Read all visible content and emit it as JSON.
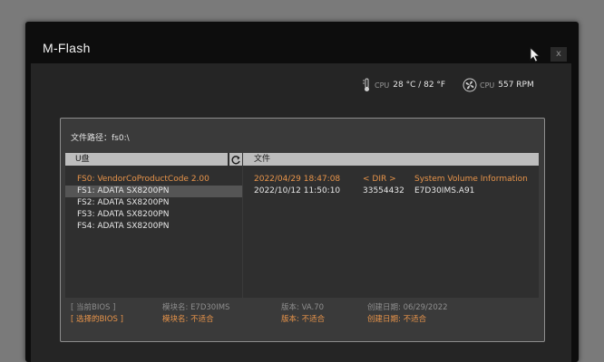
{
  "window": {
    "title": "M-Flash",
    "close_label": "x"
  },
  "stats": {
    "temp_label": "CPU",
    "temp_value": "28 °C / 82 °F",
    "fan_label": "CPU",
    "fan_value": "557 RPM"
  },
  "dialog": {
    "path": "文件路径：fs0:\\",
    "usb_header": "U盘",
    "file_header": "文件",
    "drives": [
      "FS0: VendorCoProductCode 2.00",
      "FS1: ADATA SX8200PN",
      "FS2: ADATA SX8200PN",
      "FS3: ADATA SX8200PN",
      "FS4: ADATA SX8200PN"
    ],
    "files": [
      {
        "date": "2022/04/29 18:47:08",
        "size": "< DIR >",
        "name": "System Volume Information"
      },
      {
        "date": "2022/10/12 11:50:10",
        "size": "33554432",
        "name": "E7D30IMS.A91"
      }
    ],
    "info": {
      "current": {
        "bios": "[    当前BIOS    ]",
        "model": "模块名: E7D30IMS",
        "version": "版本: VA.70",
        "date": "创建日期: 06/29/2022"
      },
      "selected": {
        "bios": "[  选择的BIOS  ]",
        "model": "模块名: 不适合",
        "version": "版本: 不适合",
        "date": "创建日期: 不适合"
      }
    }
  },
  "colors": {
    "accent": "#e8944a",
    "panel": "#252525",
    "dialog": "#3a3a3a",
    "header": "#bdbdbd"
  }
}
